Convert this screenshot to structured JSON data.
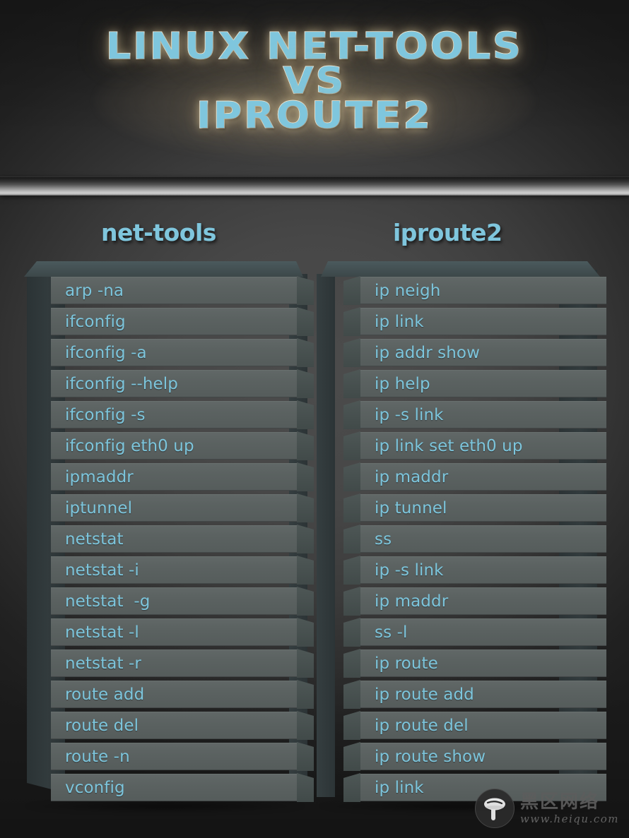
{
  "poster": {
    "title_lines": [
      "LINUX NET-TOOLS",
      "VS",
      "IPROUTE2"
    ],
    "accent_color": "#7fc6dd",
    "glow_color": "#ffe8b4",
    "background_center": "#474747",
    "background_edge": "#1c1c1c",
    "divider_highlight": "#cfcfcf"
  },
  "columns": {
    "left": {
      "header": "net-tools",
      "rows": [
        "arp -na",
        "ifconfig",
        "ifconfig -a",
        "ifconfig --help",
        "ifconfig -s",
        "ifconfig eth0 up",
        "ipmaddr",
        "iptunnel",
        "netstat",
        "netstat -i",
        "netstat  -g",
        "netstat -l",
        "netstat -r",
        "route add",
        "route del",
        "route -n",
        "vconfig"
      ]
    },
    "right": {
      "header": "iproute2",
      "rows": [
        "ip neigh",
        "ip link",
        "ip addr show",
        "ip help",
        "ip -s link",
        "ip link set eth0 up",
        "ip maddr",
        "ip tunnel",
        "ss",
        "ip -s link",
        "ip maddr",
        "ss -l",
        "ip route",
        "ip route add",
        "ip route del",
        "ip route show",
        "ip link"
      ]
    }
  },
  "watermark": {
    "cn_text": "黑区网络",
    "url_text": "www.heiqu.com",
    "icon": "mushroom-icon"
  }
}
